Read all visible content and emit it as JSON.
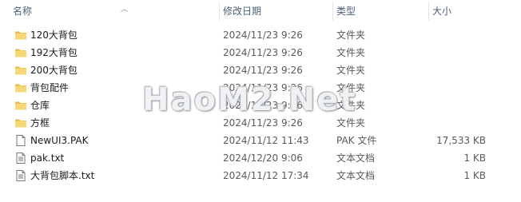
{
  "columns": {
    "name": "名称",
    "modified": "修改日期",
    "type": "类型",
    "size": "大小"
  },
  "files": [
    {
      "name": "120大背包",
      "modified": "2024/11/23 9:26",
      "type": "文件夹",
      "size": "",
      "icon": "folder-icon"
    },
    {
      "name": "192大背包",
      "modified": "2024/11/23 9:26",
      "type": "文件夹",
      "size": "",
      "icon": "folder-icon"
    },
    {
      "name": "200大背包",
      "modified": "2024/11/23 9:26",
      "type": "文件夹",
      "size": "",
      "icon": "folder-icon"
    },
    {
      "name": "背包配件",
      "modified": "2024/11/23 9:26",
      "type": "文件夹",
      "size": "",
      "icon": "folder-icon"
    },
    {
      "name": "仓库",
      "modified": "2024/11/23 9:26",
      "type": "文件夹",
      "size": "",
      "icon": "folder-icon"
    },
    {
      "name": "方框",
      "modified": "2024/11/23 9:26",
      "type": "文件夹",
      "size": "",
      "icon": "folder-icon"
    },
    {
      "name": "NewUI3.PAK",
      "modified": "2024/11/12 11:43",
      "type": "PAK 文件",
      "size": "17,533 KB",
      "icon": "file-icon"
    },
    {
      "name": "pak.txt",
      "modified": "2024/12/20 9:06",
      "type": "文本文档",
      "size": "1 KB",
      "icon": "text-file-icon"
    },
    {
      "name": "大背包脚本.txt",
      "modified": "2024/11/12 17:34",
      "type": "文本文档",
      "size": "1 KB",
      "icon": "text-file-icon"
    }
  ],
  "watermark": "HaoM2.Net",
  "colors": {
    "folder": "#f8d775",
    "folder_dark": "#e8b83e",
    "header_text": "#4c607a"
  }
}
